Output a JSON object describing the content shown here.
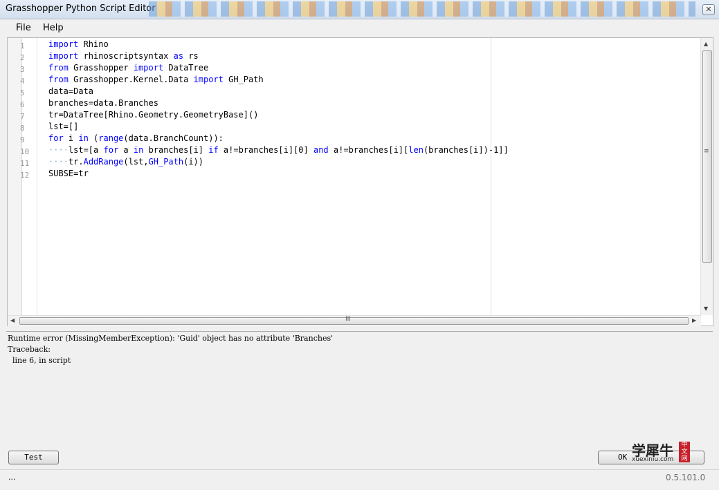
{
  "window": {
    "title": "Grasshopper Python Script Editor",
    "close_glyph": "✕"
  },
  "menu": {
    "file": "File",
    "help": "Help"
  },
  "editor": {
    "line_numbers": [
      "1",
      "2",
      "3",
      "4",
      "5",
      "6",
      "7",
      "8",
      "9",
      "10",
      "11",
      "12"
    ],
    "lines": [
      [
        {
          "t": "import",
          "c": "kw"
        },
        {
          "t": " Rhino"
        }
      ],
      [
        {
          "t": "import",
          "c": "kw"
        },
        {
          "t": " rhinoscriptsyntax "
        },
        {
          "t": "as",
          "c": "kw"
        },
        {
          "t": " rs"
        }
      ],
      [
        {
          "t": "from",
          "c": "kw"
        },
        {
          "t": " Grasshopper "
        },
        {
          "t": "import",
          "c": "kw"
        },
        {
          "t": " DataTree"
        }
      ],
      [
        {
          "t": "from",
          "c": "kw"
        },
        {
          "t": " Grasshopper.Kernel.Data "
        },
        {
          "t": "import",
          "c": "kw"
        },
        {
          "t": " GH_Path"
        }
      ],
      [
        {
          "t": "data=Data"
        }
      ],
      [
        {
          "t": "branches=data.Branches"
        }
      ],
      [
        {
          "t": "tr=DataTree[Rhino.Geometry.GeometryBase]()"
        }
      ],
      [
        {
          "t": "lst=[]"
        }
      ],
      [
        {
          "t": "for",
          "c": "kw"
        },
        {
          "t": " i "
        },
        {
          "t": "in",
          "c": "kw"
        },
        {
          "t": " ("
        },
        {
          "t": "range",
          "c": "bi"
        },
        {
          "t": "(data.BranchCount)):"
        }
      ],
      [
        {
          "t": "····",
          "c": "ws"
        },
        {
          "t": "lst=[a "
        },
        {
          "t": "for",
          "c": "kw"
        },
        {
          "t": " a "
        },
        {
          "t": "in",
          "c": "kw"
        },
        {
          "t": " branches[i] "
        },
        {
          "t": "if",
          "c": "kw"
        },
        {
          "t": " a!=branches[i][0] "
        },
        {
          "t": "and",
          "c": "kw"
        },
        {
          "t": " a!=branches[i]["
        },
        {
          "t": "len",
          "c": "bi"
        },
        {
          "t": "(branches[i])-1]]"
        }
      ],
      [
        {
          "t": "····",
          "c": "ws"
        },
        {
          "t": "tr."
        },
        {
          "t": "AddRange",
          "c": "bi"
        },
        {
          "t": "(lst,"
        },
        {
          "t": "GH_Path",
          "c": "bi"
        },
        {
          "t": "(i))"
        }
      ],
      [
        {
          "t": "SUBSE=tr"
        }
      ]
    ],
    "hscroll_grip": "III",
    "vscroll_grip": "≡"
  },
  "output": {
    "lines": [
      "Runtime error (MissingMemberException): 'Guid' object has no attribute 'Branches'",
      "Traceback:",
      "  line 6, in script"
    ]
  },
  "buttons": {
    "test": "Test",
    "ok": "OK"
  },
  "watermark": {
    "brand": "学犀牛",
    "site": "xuexiniu.com",
    "badge": "中文网"
  },
  "status": {
    "left": "...",
    "version": "0.5.101.0"
  },
  "colors": {
    "keyword": "#0000ff",
    "whitespace_marker": "#7bb3c9"
  }
}
